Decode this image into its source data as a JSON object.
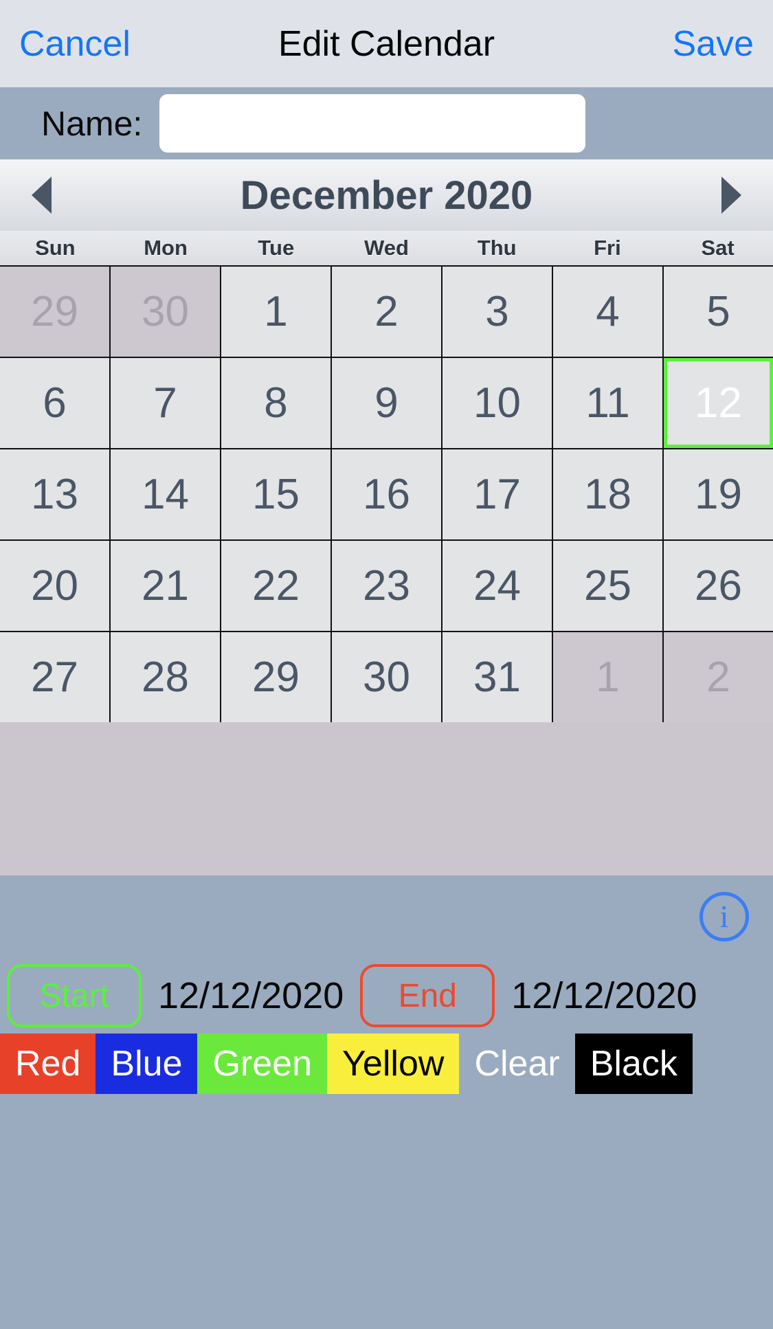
{
  "navbar": {
    "cancel_label": "Cancel",
    "title": "Edit Calendar",
    "save_label": "Save"
  },
  "name_row": {
    "label": "Name:",
    "value": "",
    "placeholder": ""
  },
  "calendar": {
    "prev_icon": "triangle-left-icon",
    "next_icon": "triangle-right-icon",
    "month_title": "December 2020",
    "weekdays": [
      "Sun",
      "Mon",
      "Tue",
      "Wed",
      "Thu",
      "Fri",
      "Sat"
    ],
    "selected_day": "12",
    "selected_outline_color": "#5cf03c",
    "days": [
      {
        "n": "29",
        "other": true
      },
      {
        "n": "30",
        "other": true
      },
      {
        "n": "1",
        "other": false
      },
      {
        "n": "2",
        "other": false
      },
      {
        "n": "3",
        "other": false
      },
      {
        "n": "4",
        "other": false
      },
      {
        "n": "5",
        "other": false
      },
      {
        "n": "6",
        "other": false
      },
      {
        "n": "7",
        "other": false
      },
      {
        "n": "8",
        "other": false
      },
      {
        "n": "9",
        "other": false
      },
      {
        "n": "10",
        "other": false
      },
      {
        "n": "11",
        "other": false
      },
      {
        "n": "12",
        "other": false,
        "selected": true
      },
      {
        "n": "13",
        "other": false
      },
      {
        "n": "14",
        "other": false
      },
      {
        "n": "15",
        "other": false
      },
      {
        "n": "16",
        "other": false
      },
      {
        "n": "17",
        "other": false
      },
      {
        "n": "18",
        "other": false
      },
      {
        "n": "19",
        "other": false
      },
      {
        "n": "20",
        "other": false
      },
      {
        "n": "21",
        "other": false
      },
      {
        "n": "22",
        "other": false
      },
      {
        "n": "23",
        "other": false
      },
      {
        "n": "24",
        "other": false
      },
      {
        "n": "25",
        "other": false
      },
      {
        "n": "26",
        "other": false
      },
      {
        "n": "27",
        "other": false
      },
      {
        "n": "28",
        "other": false
      },
      {
        "n": "29",
        "other": false
      },
      {
        "n": "30",
        "other": false
      },
      {
        "n": "31",
        "other": false
      },
      {
        "n": "1",
        "other": true
      },
      {
        "n": "2",
        "other": true
      }
    ]
  },
  "bottom": {
    "info_icon": "info-circle-icon",
    "start_label": "Start",
    "start_date": "12/12/2020",
    "end_label": "End",
    "end_date": "12/12/2020",
    "start_color": "#5cf03c",
    "end_color": "#ec4a2e",
    "colors": [
      {
        "label": "Red",
        "bg": "#e8412a",
        "fg": "#ffffff"
      },
      {
        "label": "Blue",
        "bg": "#1a2ce0",
        "fg": "#ffffff"
      },
      {
        "label": "Green",
        "bg": "#6be83c",
        "fg": "#ffffff"
      },
      {
        "label": "Yellow",
        "bg": "#faee3c",
        "fg": "#000000"
      },
      {
        "label": "Clear",
        "bg": "transparent",
        "fg": "#ffffff"
      },
      {
        "label": "Black",
        "bg": "#000000",
        "fg": "#ffffff"
      }
    ]
  }
}
